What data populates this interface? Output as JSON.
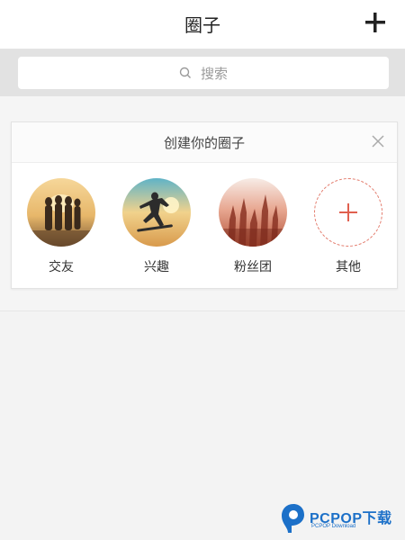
{
  "header": {
    "title": "圈子"
  },
  "search": {
    "placeholder": "搜索"
  },
  "card": {
    "title": "创建你的圈子",
    "categories": [
      {
        "label": "交友"
      },
      {
        "label": "兴趣"
      },
      {
        "label": "粉丝团"
      },
      {
        "label": "其他"
      }
    ]
  },
  "watermark": {
    "brand": "PCPOP下载",
    "sub": "PCPOP Download"
  },
  "colors": {
    "accent": "#e0604f",
    "watermark_blue": "#1c70c8"
  }
}
